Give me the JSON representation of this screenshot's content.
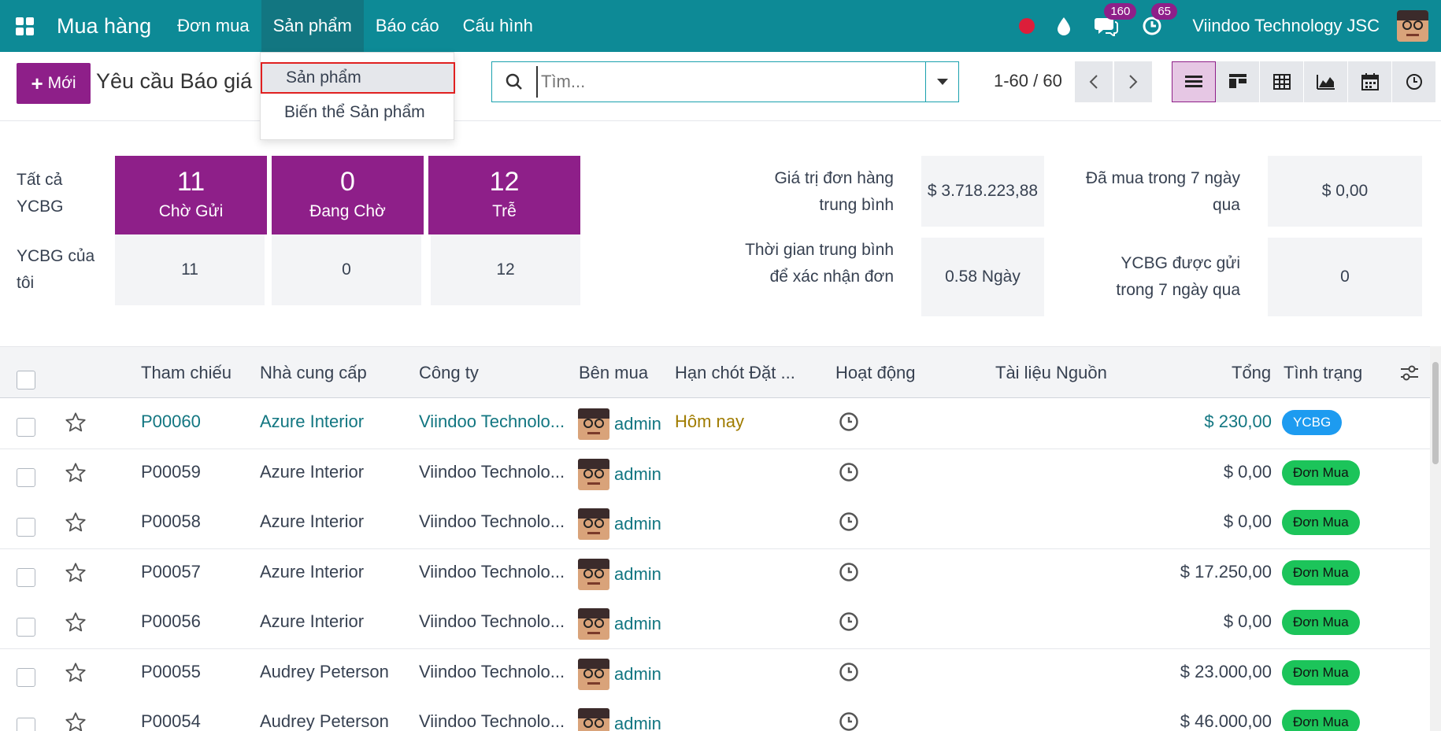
{
  "navbar": {
    "brand": "Mua hàng",
    "menus": [
      {
        "label": "Đơn mua"
      },
      {
        "label": "Sản phẩm"
      },
      {
        "label": "Báo cáo"
      },
      {
        "label": "Cấu hình"
      }
    ],
    "messages_count": "160",
    "activities_count": "65",
    "company": "Viindoo Technology JSC"
  },
  "dropdown": {
    "items": [
      {
        "label": "Sản phẩm"
      },
      {
        "label": "Biến thể Sản phẩm"
      }
    ]
  },
  "control": {
    "new_label": "Mới",
    "title": "Yêu cầu Báo giá",
    "search_placeholder": "Tìm...",
    "pager": "1-60 / 60"
  },
  "dashboard": {
    "all_label": "Tất cả YCBG",
    "mine_label": "YCBG của tôi",
    "tiles": [
      {
        "count": "11",
        "label": "Chờ Gửi",
        "mine": "11"
      },
      {
        "count": "0",
        "label": "Đang Chờ",
        "mine": "0"
      },
      {
        "count": "12",
        "label": "Trễ",
        "mine": "12"
      }
    ],
    "stats": {
      "avg_order_label": "Giá trị đơn hàng trung bình",
      "avg_order_value": "$ 3.718.223,88",
      "purchased_label": "Đã mua trong 7 ngày qua",
      "purchased_value": "$ 0,00",
      "avg_confirm_label": "Thời gian trung bình để xác nhận đơn",
      "avg_confirm_value": "0.58 Ngày",
      "sent_label": "YCBG được gửi trong 7 ngày qua",
      "sent_value": "0"
    }
  },
  "table": {
    "columns": {
      "ref": "Tham chiếu",
      "vendor": "Nhà cung cấp",
      "company": "Công ty",
      "buyer": "Bên mua",
      "deadline": "Hạn chót Đặt ...",
      "activity": "Hoạt động",
      "source": "Tài liệu Nguồn",
      "total": "Tổng",
      "status": "Tình trạng"
    },
    "rows": [
      {
        "ref": "P00060",
        "vendor": "Azure Interior",
        "company": "Viindoo Technolo...",
        "buyer": "admin",
        "deadline": "Hôm nay",
        "total": "$ 230,00",
        "status": "YCBG"
      },
      {
        "ref": "P00059",
        "vendor": "Azure Interior",
        "company": "Viindoo Technolo...",
        "buyer": "admin",
        "deadline": "",
        "total": "$ 0,00",
        "status": "Đơn Mua"
      },
      {
        "ref": "P00058",
        "vendor": "Azure Interior",
        "company": "Viindoo Technolo...",
        "buyer": "admin",
        "deadline": "",
        "total": "$ 0,00",
        "status": "Đơn Mua"
      },
      {
        "ref": "P00057",
        "vendor": "Azure Interior",
        "company": "Viindoo Technolo...",
        "buyer": "admin",
        "deadline": "",
        "total": "$ 17.250,00",
        "status": "Đơn Mua"
      },
      {
        "ref": "P00056",
        "vendor": "Azure Interior",
        "company": "Viindoo Technolo...",
        "buyer": "admin",
        "deadline": "",
        "total": "$ 0,00",
        "status": "Đơn Mua"
      },
      {
        "ref": "P00055",
        "vendor": "Audrey Peterson",
        "company": "Viindoo Technolo...",
        "buyer": "admin",
        "deadline": "",
        "total": "$ 23.000,00",
        "status": "Đơn Mua"
      },
      {
        "ref": "P00054",
        "vendor": "Audrey Peterson",
        "company": "Viindoo Technolo...",
        "buyer": "admin",
        "deadline": "",
        "total": "$ 46.000,00",
        "status": "Đơn Mua"
      }
    ]
  }
}
